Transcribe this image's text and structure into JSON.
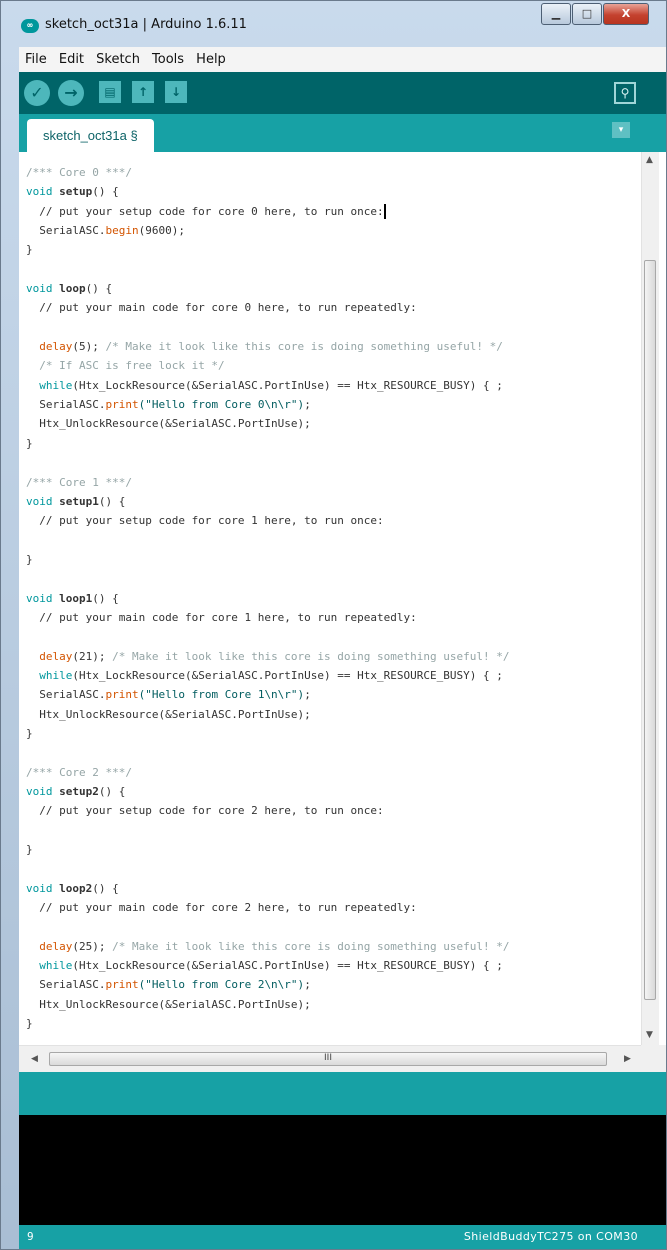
{
  "window": {
    "title": "sketch_oct31a | Arduino 1.6.11",
    "app_icon_text": "∞",
    "minimize_glyph": "▁",
    "maximize_glyph": "□",
    "close_glyph": "X"
  },
  "menu": [
    "File",
    "Edit",
    "Sketch",
    "Tools",
    "Help"
  ],
  "toolbar": {
    "verify_icon": "✓",
    "upload_icon": "→",
    "new_icon": "▤",
    "open_icon": "↑",
    "save_icon": "↓",
    "serial_monitor_icon": "⚲"
  },
  "tabs": [
    {
      "label": "sketch_oct31a §"
    }
  ],
  "tab_menu_glyph": "▾",
  "editor": {
    "lines": [
      [
        [
          "comment",
          "/*** Core 0 ***/"
        ]
      ],
      [
        [
          "keyword",
          "void "
        ],
        [
          "plain",
          "setup",
          "bold"
        ],
        [
          "plain",
          "() {"
        ]
      ],
      [
        [
          "plain",
          "  // put your setup code for core 0 here, to run once:"
        ],
        [
          "cursor",
          ""
        ]
      ],
      [
        [
          "plain",
          "  SerialASC."
        ],
        [
          "func",
          "begin"
        ],
        [
          "plain",
          "(9600);"
        ]
      ],
      [
        [
          "plain",
          "}"
        ]
      ],
      [
        [
          "plain",
          ""
        ]
      ],
      [
        [
          "keyword",
          "void "
        ],
        [
          "plain",
          "loop",
          "bold"
        ],
        [
          "plain",
          "() {"
        ]
      ],
      [
        [
          "plain",
          "  // put your main code for core 0 here, to run repeatedly:"
        ]
      ],
      [
        [
          "plain",
          ""
        ]
      ],
      [
        [
          "plain",
          "  "
        ],
        [
          "func",
          "delay"
        ],
        [
          "plain",
          "(5); "
        ],
        [
          "comment",
          "/* Make it look like this core is doing something useful! */"
        ]
      ],
      [
        [
          "plain",
          "  "
        ],
        [
          "comment",
          "/* If ASC is free lock it */"
        ]
      ],
      [
        [
          "plain",
          "  "
        ],
        [
          "keyword",
          "while"
        ],
        [
          "plain",
          "(Htx_LockResource(&SerialASC.PortInUse) == Htx_RESOURCE_BUSY) { ;"
        ]
      ],
      [
        [
          "plain",
          "  SerialASC."
        ],
        [
          "func",
          "print"
        ],
        [
          "string",
          "(\"Hello from Core 0\\n\\r\")"
        ],
        [
          "plain",
          ";"
        ]
      ],
      [
        [
          "plain",
          "  Htx_UnlockResource(&SerialASC.PortInUse);"
        ]
      ],
      [
        [
          "plain",
          "}"
        ]
      ],
      [
        [
          "plain",
          ""
        ]
      ],
      [
        [
          "comment",
          "/*** Core 1 ***/"
        ]
      ],
      [
        [
          "keyword",
          "void "
        ],
        [
          "plain",
          "setup1",
          "bold"
        ],
        [
          "plain",
          "() {"
        ]
      ],
      [
        [
          "plain",
          "  // put your setup code for core 1 here, to run once:"
        ]
      ],
      [
        [
          "plain",
          ""
        ]
      ],
      [
        [
          "plain",
          "}"
        ]
      ],
      [
        [
          "plain",
          ""
        ]
      ],
      [
        [
          "keyword",
          "void "
        ],
        [
          "plain",
          "loop1",
          "bold"
        ],
        [
          "plain",
          "() {"
        ]
      ],
      [
        [
          "plain",
          "  // put your main code for core 1 here, to run repeatedly:"
        ]
      ],
      [
        [
          "plain",
          ""
        ]
      ],
      [
        [
          "plain",
          "  "
        ],
        [
          "func",
          "delay"
        ],
        [
          "plain",
          "(21); "
        ],
        [
          "comment",
          "/* Make it look like this core is doing something useful! */"
        ]
      ],
      [
        [
          "plain",
          "  "
        ],
        [
          "keyword",
          "while"
        ],
        [
          "plain",
          "(Htx_LockResource(&SerialASC.PortInUse) == Htx_RESOURCE_BUSY) { ;"
        ]
      ],
      [
        [
          "plain",
          "  SerialASC."
        ],
        [
          "func",
          "print"
        ],
        [
          "string",
          "(\"Hello from Core 1\\n\\r\")"
        ],
        [
          "plain",
          ";"
        ]
      ],
      [
        [
          "plain",
          "  Htx_UnlockResource(&SerialASC.PortInUse);"
        ]
      ],
      [
        [
          "plain",
          "}"
        ]
      ],
      [
        [
          "plain",
          ""
        ]
      ],
      [
        [
          "comment",
          "/*** Core 2 ***/"
        ]
      ],
      [
        [
          "keyword",
          "void "
        ],
        [
          "plain",
          "setup2",
          "bold"
        ],
        [
          "plain",
          "() {"
        ]
      ],
      [
        [
          "plain",
          "  // put your setup code for core 2 here, to run once:"
        ]
      ],
      [
        [
          "plain",
          ""
        ]
      ],
      [
        [
          "plain",
          "}"
        ]
      ],
      [
        [
          "plain",
          ""
        ]
      ],
      [
        [
          "keyword",
          "void "
        ],
        [
          "plain",
          "loop2",
          "bold"
        ],
        [
          "plain",
          "() {"
        ]
      ],
      [
        [
          "plain",
          "  // put your main code for core 2 here, to run repeatedly:"
        ]
      ],
      [
        [
          "plain",
          ""
        ]
      ],
      [
        [
          "plain",
          "  "
        ],
        [
          "func",
          "delay"
        ],
        [
          "plain",
          "(25); "
        ],
        [
          "comment",
          "/* Make it look like this core is doing something useful! */"
        ]
      ],
      [
        [
          "plain",
          "  "
        ],
        [
          "keyword",
          "while"
        ],
        [
          "plain",
          "(Htx_LockResource(&SerialASC.PortInUse) == Htx_RESOURCE_BUSY) { ;"
        ]
      ],
      [
        [
          "plain",
          "  SerialASC."
        ],
        [
          "func",
          "print"
        ],
        [
          "string",
          "(\"Hello from Core 2\\n\\r\")"
        ],
        [
          "plain",
          ";"
        ]
      ],
      [
        [
          "plain",
          "  Htx_UnlockResource(&SerialASC.PortInUse);"
        ]
      ],
      [
        [
          "plain",
          "}"
        ]
      ]
    ]
  },
  "scrollbar": {
    "up_arrow": "▲",
    "down_arrow": "▼",
    "left_arrow": "◀",
    "right_arrow": "▶",
    "grip": "III"
  },
  "status": {
    "line_number": "9",
    "board": "ShieldBuddyTC275 on COM30"
  },
  "colors": {
    "toolbar": "#006468",
    "tab_bar": "#17a1a5",
    "keyword": "#00979d",
    "function": "#d35400",
    "comment": "#95a5a6",
    "console": "#000000"
  }
}
